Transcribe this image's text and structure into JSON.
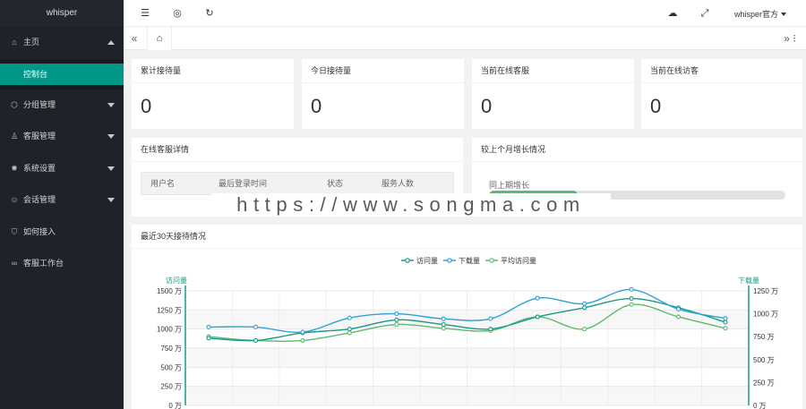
{
  "app": {
    "title": "whisper"
  },
  "sidebar": {
    "items": [
      {
        "label": "主页",
        "icon": "home-icon",
        "glyph": "⌂",
        "arrow": "up"
      },
      {
        "label": "分组管理",
        "icon": "box-icon",
        "glyph": "⬡",
        "arrow": "down"
      },
      {
        "label": "客服管理",
        "icon": "user-icon",
        "glyph": "♙",
        "arrow": "down"
      },
      {
        "label": "系统设置",
        "icon": "gear-icon",
        "glyph": "✹",
        "arrow": "down"
      },
      {
        "label": "会话管理",
        "icon": "chat-icon",
        "glyph": "☺",
        "arrow": "down"
      },
      {
        "label": "如何接入",
        "icon": "shield-icon",
        "glyph": "⛉",
        "arrow": null
      },
      {
        "label": "客服工作台",
        "icon": "link-icon",
        "glyph": "∞",
        "arrow": null
      }
    ],
    "sub_active": "控制台"
  },
  "header": {
    "user": "whisper官方"
  },
  "stats": [
    {
      "title": "累计接待量",
      "value": "0"
    },
    {
      "title": "今日接待量",
      "value": "0"
    },
    {
      "title": "当前在线客服",
      "value": "0"
    },
    {
      "title": "当前在线访客",
      "value": "0"
    }
  ],
  "online_panel": {
    "title": "在线客服详情",
    "columns": [
      "用户名",
      "最后登录时间",
      "状态",
      "服务人数"
    ]
  },
  "growth_panel": {
    "title": "较上个月增长情况",
    "label": "同上期增长",
    "percent": 30
  },
  "watermark": "https://www.songma.com",
  "chart_panel": {
    "title": "最近30天接待情况"
  },
  "chart_data": {
    "type": "line",
    "legend": [
      "访问量",
      "下载量",
      "平均访问量"
    ],
    "legend_position": "top-center",
    "colors": [
      "#1a9a86",
      "#2ea1d9",
      "#5dbb6b"
    ],
    "y_left": {
      "label": "访问量",
      "ticks": [
        "0 万",
        "250 万",
        "500 万",
        "750 万",
        "1000 万",
        "1250 万",
        "1500 万"
      ],
      "range": [
        0,
        1500
      ]
    },
    "y_right": {
      "label": "下载量",
      "ticks": [
        "0 万",
        "250 万",
        "500 万",
        "750 万",
        "1000 万",
        "1250 万"
      ],
      "range": [
        0,
        1250
      ]
    },
    "series": [
      {
        "name": "访问量",
        "axis": "left",
        "values": [
          880,
          850,
          950,
          1000,
          1120,
          1060,
          1000,
          1160,
          1280,
          1400,
          1280,
          1090
        ]
      },
      {
        "name": "下载量",
        "axis": "right",
        "values": [
          855,
          855,
          800,
          955,
          1000,
          945,
          945,
          1170,
          1110,
          1265,
          1050,
          950
        ]
      },
      {
        "name": "平均访问量",
        "axis": "left",
        "values": [
          900,
          850,
          850,
          950,
          1060,
          1010,
          980,
          1160,
          1000,
          1320,
          1160,
          1010
        ]
      }
    ]
  }
}
